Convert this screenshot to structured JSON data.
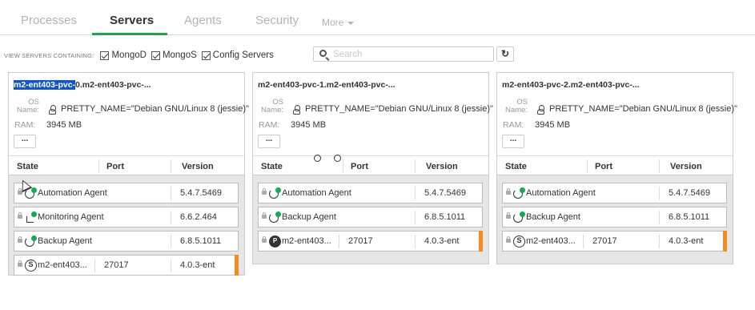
{
  "tabs": [
    {
      "label": "Processes"
    },
    {
      "label": "Servers"
    },
    {
      "label": "Agents"
    },
    {
      "label": "Security"
    },
    {
      "label": "More"
    }
  ],
  "filter": {
    "label": "VIEW SERVERS CONTAINING:",
    "options": [
      "MongoD",
      "MongoS",
      "Config Servers"
    ],
    "search_placeholder": "Search",
    "refresh_icon": "refresh-icon"
  },
  "colors": {
    "accent": "#13aa52",
    "warning": "#f68920",
    "selection": "#1155cc"
  },
  "table_headers": {
    "state": "State",
    "port": "Port",
    "version": "Version"
  },
  "servers": [
    {
      "title_selected": "m2-ent403-pvc-",
      "title_rest": "0.m2-ent403-pvc-...",
      "os_key": "OS Name:",
      "os": "PRETTY_NAME=\"Debian GNU/Linux 8 (jessie)\"",
      "ram_key": "RAM:",
      "ram": "3945 MB",
      "more": "...",
      "rows": [
        {
          "name": "Automation Agent",
          "port": "",
          "version": "5.4.7.5469",
          "icon": "automation-agent-icon"
        },
        {
          "name": "Monitoring Agent",
          "port": "",
          "version": "6.6.2.464",
          "icon": "monitoring-agent-icon"
        },
        {
          "name": "Backup Agent",
          "port": "",
          "version": "6.8.5.1011",
          "icon": "backup-agent-icon"
        },
        {
          "name": "m2-ent403...",
          "port": "27017",
          "version": "4.0.3-ent",
          "icon": "standalone-icon",
          "badge": "S"
        }
      ]
    },
    {
      "title_selected": "",
      "title_rest": "m2-ent403-pvc-1.m2-ent403-pvc-...",
      "os_key": "OS Name:",
      "os": "PRETTY_NAME=\"Debian GNU/Linux 8 (jessie)\"",
      "ram_key": "RAM:",
      "ram": "3945 MB",
      "more": "...",
      "rows": [
        {
          "name": "Automation Agent",
          "port": "",
          "version": "5.4.7.5469",
          "icon": "automation-agent-icon"
        },
        {
          "name": "Backup Agent",
          "port": "",
          "version": "6.8.5.1011",
          "icon": "backup-agent-icon"
        },
        {
          "name": "m2-ent403...",
          "port": "27017",
          "version": "4.0.3-ent",
          "icon": "primary-icon",
          "badge": "P"
        }
      ]
    },
    {
      "title_selected": "",
      "title_rest": "m2-ent403-pvc-2.m2-ent403-pvc-...",
      "os_key": "OS Name:",
      "os": "PRETTY_NAME=\"Debian GNU/Linux 8 (jessie)\"",
      "ram_key": "RAM:",
      "ram": "3945 MB",
      "more": "...",
      "rows": [
        {
          "name": "Automation Agent",
          "port": "",
          "version": "5.4.7.5469",
          "icon": "automation-agent-icon"
        },
        {
          "name": "Backup Agent",
          "port": "",
          "version": "6.8.5.1011",
          "icon": "backup-agent-icon"
        },
        {
          "name": "m2-ent403...",
          "port": "27017",
          "version": "4.0.3-ent",
          "icon": "standalone-icon",
          "badge": "S"
        }
      ]
    }
  ]
}
